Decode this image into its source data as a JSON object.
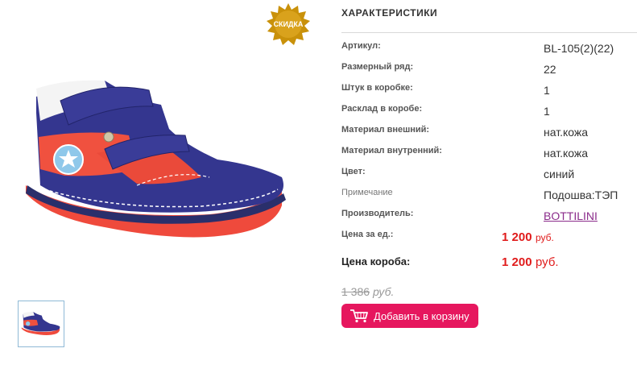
{
  "badge": {
    "label": "СКИДКА"
  },
  "specs": {
    "title": "ХАРАКТЕРИСТИКИ",
    "rows": [
      {
        "label": "Артикул:",
        "value": "BL-105(2)(22)"
      },
      {
        "label": "Размерный ряд:",
        "value": "22"
      },
      {
        "label": "Штук в коробке:",
        "value": "1"
      },
      {
        "label": "Расклад в коробе:",
        "value": "1"
      },
      {
        "label": "Материал внешний:",
        "value": "нат.кожа"
      },
      {
        "label": "Материал внутренний:",
        "value": "нат.кожа"
      },
      {
        "label": "Цвет:",
        "value": "синий"
      },
      {
        "label": "Примечание",
        "value": "Подошва:ТЭП"
      },
      {
        "label": "Производитель:",
        "value": "BOTTILINI"
      }
    ]
  },
  "prices": {
    "unit_label": "Цена за ед.:",
    "unit_amount": "1 200",
    "unit_currency": "руб.",
    "box_label": "Цена короба:",
    "box_amount": "1 200",
    "box_currency": "руб.",
    "old_amount": "1 386",
    "old_currency": "руб."
  },
  "cart": {
    "label": "Добавить в корзину"
  },
  "colors": {
    "accent": "#e6175e",
    "price": "#e01b1b",
    "link": "#8b2c8b",
    "badge": "#c9910a"
  },
  "icons": {
    "badge": "starburst-badge-icon",
    "cart": "shopping-cart-icon"
  }
}
